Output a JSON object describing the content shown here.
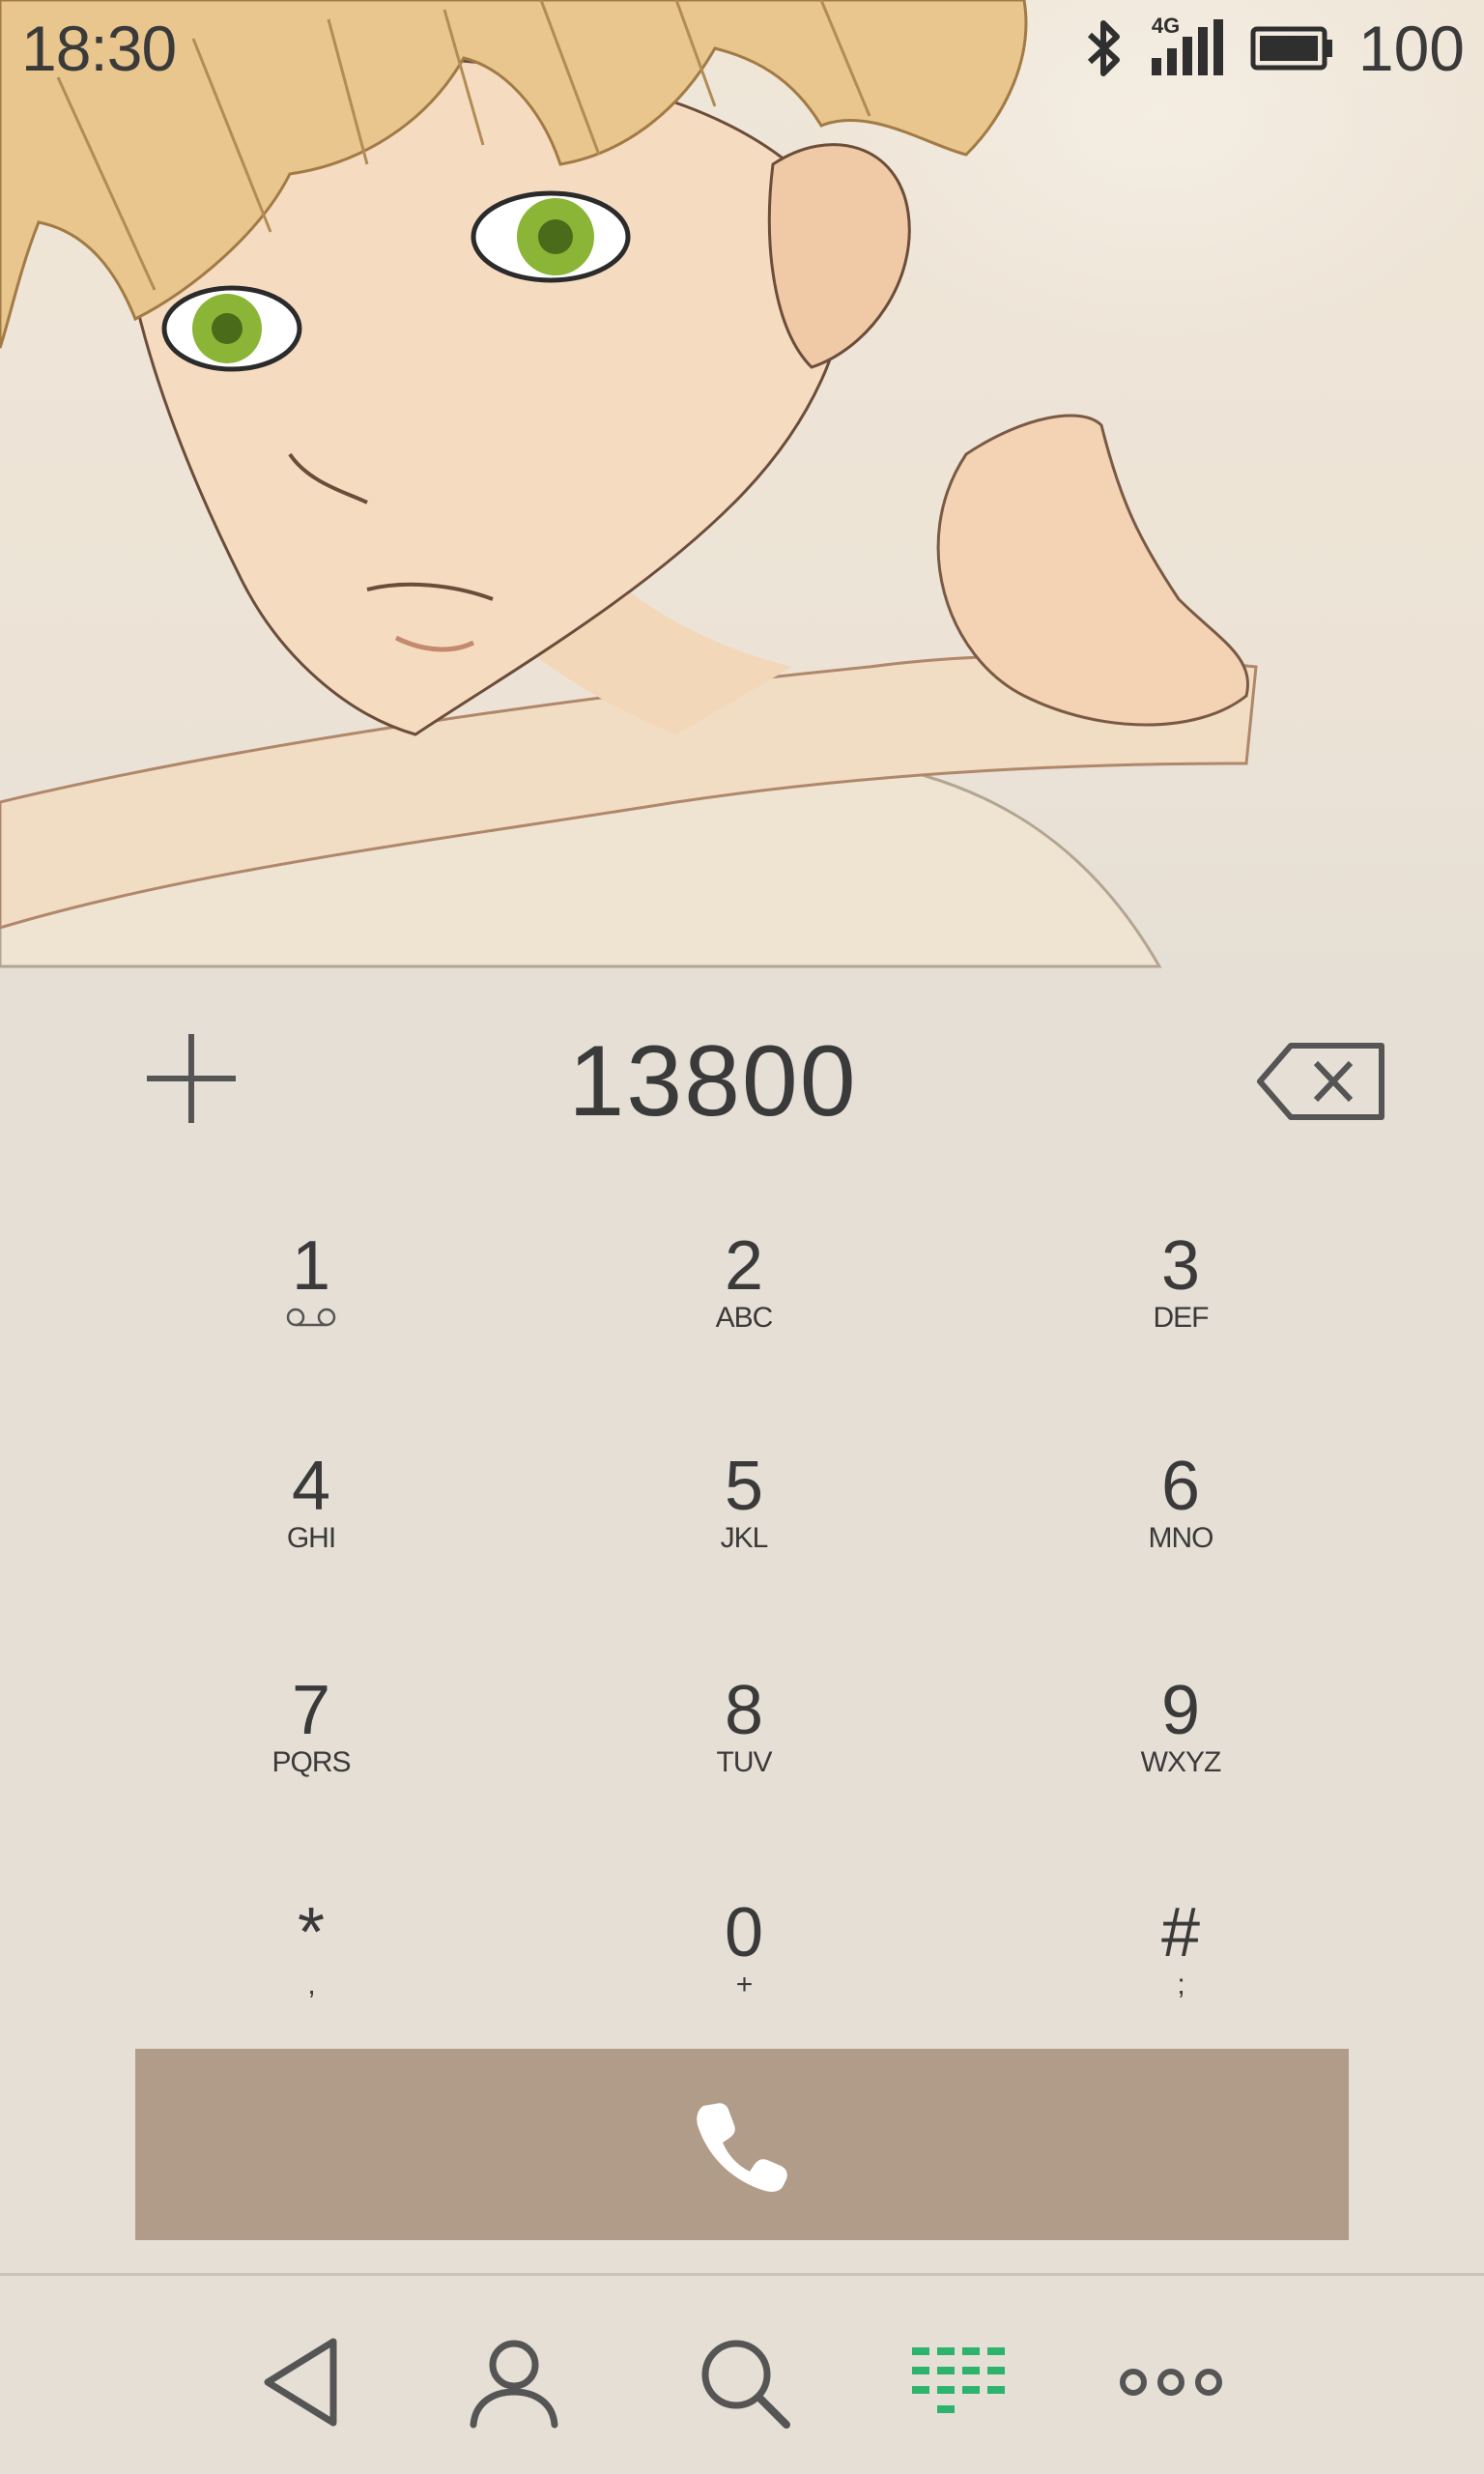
{
  "status_bar": {
    "time": "18:30",
    "network_label": "4G",
    "battery_level": "100",
    "icons": [
      "bluetooth-icon",
      "signal-4g-icon",
      "battery-icon"
    ]
  },
  "dialer": {
    "number": "13800",
    "keys": [
      {
        "digit": "1",
        "sub": "",
        "sub_icon": "voicemail-icon"
      },
      {
        "digit": "2",
        "sub": "ABC"
      },
      {
        "digit": "3",
        "sub": "DEF"
      },
      {
        "digit": "4",
        "sub": "GHI"
      },
      {
        "digit": "5",
        "sub": "JKL"
      },
      {
        "digit": "6",
        "sub": "MNO"
      },
      {
        "digit": "7",
        "sub": "PQRS"
      },
      {
        "digit": "8",
        "sub": "TUV"
      },
      {
        "digit": "9",
        "sub": "WXYZ"
      },
      {
        "digit": "*",
        "sub": ","
      },
      {
        "digit": "0",
        "sub": "+"
      },
      {
        "digit": "#",
        "sub": ";"
      }
    ]
  },
  "bottom_nav": {
    "items": [
      "back-icon",
      "contacts-icon",
      "search-icon",
      "dialpad-icon",
      "more-icon"
    ],
    "active": "dialpad-icon"
  },
  "colors": {
    "background": "#e6dfd5",
    "call_button": "#b09c88",
    "active_nav": "#2db36b",
    "text": "#3a3a3a"
  }
}
